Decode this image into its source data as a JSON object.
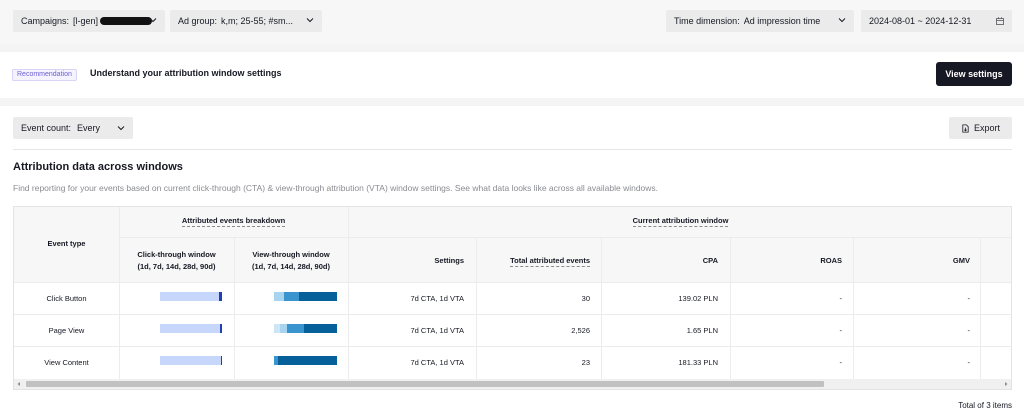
{
  "filters": {
    "campaigns_label": "Campaigns:",
    "campaigns_value": "[l-gen]",
    "adgroup_label": "Ad group:",
    "adgroup_value": "k,m; 25-55; #sm...",
    "time_label": "Time dimension:",
    "time_value": "Ad impression time",
    "date_range": "2024-08-01 ~ 2024-12-31"
  },
  "banner": {
    "tag": "Recommendation",
    "text": "Understand your attribution window settings",
    "button": "View settings"
  },
  "toolbar": {
    "event_count_label": "Event count:",
    "event_count_value": "Every",
    "export_label": "Export"
  },
  "section": {
    "title": "Attribution data across windows",
    "description": "Find reporting for your events based on current click-through (CTA) & view-through attribution (VTA) window settings. See what data looks like across all available windows."
  },
  "table": {
    "group_breakdown": "Attributed events breakdown",
    "group_current": "Current attribution window",
    "col_event_type": "Event type",
    "col_ctw": "Click-through window",
    "col_ctw_sub": "(1d, 7d, 14d, 28d, 90d)",
    "col_vtw": "View-through window",
    "col_vtw_sub": "(1d, 7d, 14d, 28d, 90d)",
    "col_settings": "Settings",
    "col_total": "Total attributed events",
    "col_cpa": "CPA",
    "col_roas": "ROAS",
    "col_gmv": "GMV",
    "rows": [
      {
        "event": "Click Button",
        "settings": "7d CTA, 1d VTA",
        "total": "30",
        "cpa": "139.02 PLN",
        "roas": "-",
        "gmv": "-"
      },
      {
        "event": "Page View",
        "settings": "7d CTA, 1d VTA",
        "total": "2,526",
        "cpa": "1.65 PLN",
        "roas": "-",
        "gmv": "-"
      },
      {
        "event": "View Content",
        "settings": "7d CTA, 1d VTA",
        "total": "23",
        "cpa": "181.33 PLN",
        "roas": "-",
        "gmv": "-"
      }
    ]
  },
  "footer": {
    "total_items": "Total of 3 items"
  },
  "colors": {
    "ctw_fill": "#c6d7fb",
    "ctw_end": "#1f3fb4",
    "vtw_light": "#a9d4f0",
    "vtw_mid": "#3a95cf",
    "vtw_dark": "#06619a",
    "primary_button": "#161823"
  },
  "icons": {
    "dropdown": "chevron-down-icon",
    "calendar": "calendar-icon",
    "export": "export-icon"
  }
}
